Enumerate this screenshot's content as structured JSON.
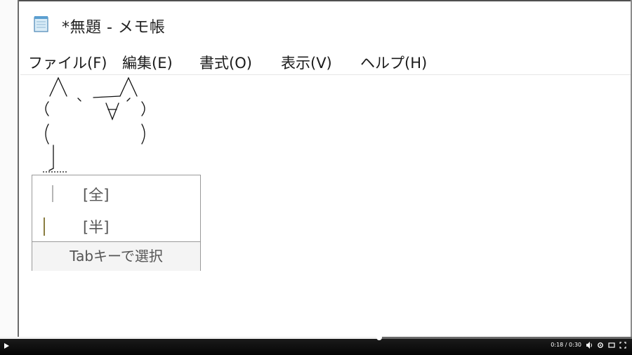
{
  "window": {
    "title": "*無題 - メモ帳"
  },
  "menu": [
    "ファイル(F)",
    "編集(E)",
    "書式(O)",
    "表示(V)",
    "ヘルプ(H)"
  ],
  "ime": {
    "candidates": [
      "[全]",
      "[半]"
    ],
    "footer": "Tabキーで選択",
    "bar_colors": [
      "#b5b5b5",
      "#8a7d42"
    ]
  },
  "player": {
    "time": "0:18 / 0:30",
    "progress": 0.6
  },
  "icons": [
    "notepad-icon",
    "play-icon",
    "volume-icon",
    "settings-icon",
    "theater-icon",
    "fullscreen-icon"
  ]
}
